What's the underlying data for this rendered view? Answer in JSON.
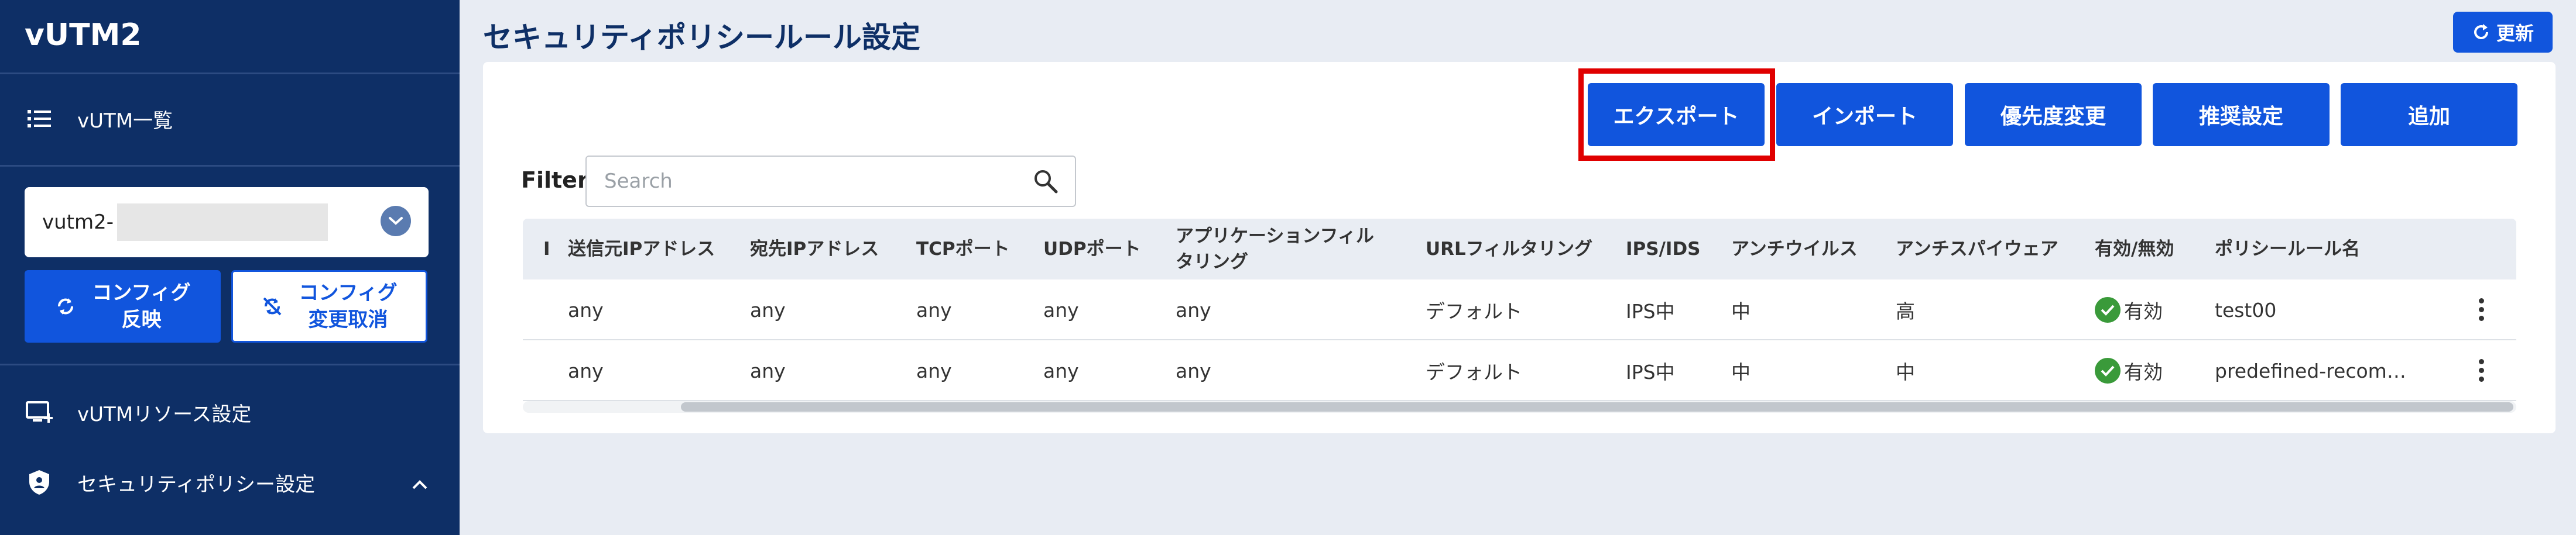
{
  "sidebar": {
    "brand": "vUTM2",
    "nav_list": "vUTM一覧",
    "select_value": "vutm2-",
    "apply_label_1": "コンフィグ",
    "apply_label_2": "反映",
    "revert_label_1": "コンフィグ",
    "revert_label_2": "変更取消",
    "nav_resource": "vUTMリソース設定",
    "nav_security": "セキュリティポリシー設定"
  },
  "header": {
    "title": "セキュリティポリシールール設定",
    "refresh_label": "更新"
  },
  "toolbar": {
    "export": "エクスポート",
    "import": "インポート",
    "priority": "優先度変更",
    "recommend": "推奨設定",
    "add": "追加"
  },
  "filter": {
    "label": "Filter",
    "placeholder": "Search"
  },
  "table": {
    "columns": [
      "I",
      "送信元IPアドレス",
      "宛先IPアドレス",
      "TCPポート",
      "UDPポート",
      "アプリケーションフィルタリング",
      "URLフィルタリング",
      "IPS/IDS",
      "アンチウイルス",
      "アンチスパイウェア",
      "有効/無効",
      "ポリシールール名"
    ],
    "col_app_line1": "アプリケーションフィル",
    "col_app_line2": "タリング",
    "rows": [
      {
        "src": "any",
        "dst": "any",
        "tcp": "any",
        "udp": "any",
        "app": "any",
        "url": "デフォルト",
        "ips": "IPS中",
        "av": "中",
        "as": "高",
        "status": "有効",
        "name": "test00"
      },
      {
        "src": "any",
        "dst": "any",
        "tcp": "any",
        "udp": "any",
        "app": "any",
        "url": "デフォルト",
        "ips": "IPS中",
        "av": "中",
        "as": "中",
        "status": "有効",
        "name": "predefined-recom…"
      }
    ]
  },
  "colors": {
    "sidebar_bg": "#0e2f66",
    "accent": "#1155dd",
    "highlight": "#e00000",
    "ok": "#3a9a3a"
  }
}
